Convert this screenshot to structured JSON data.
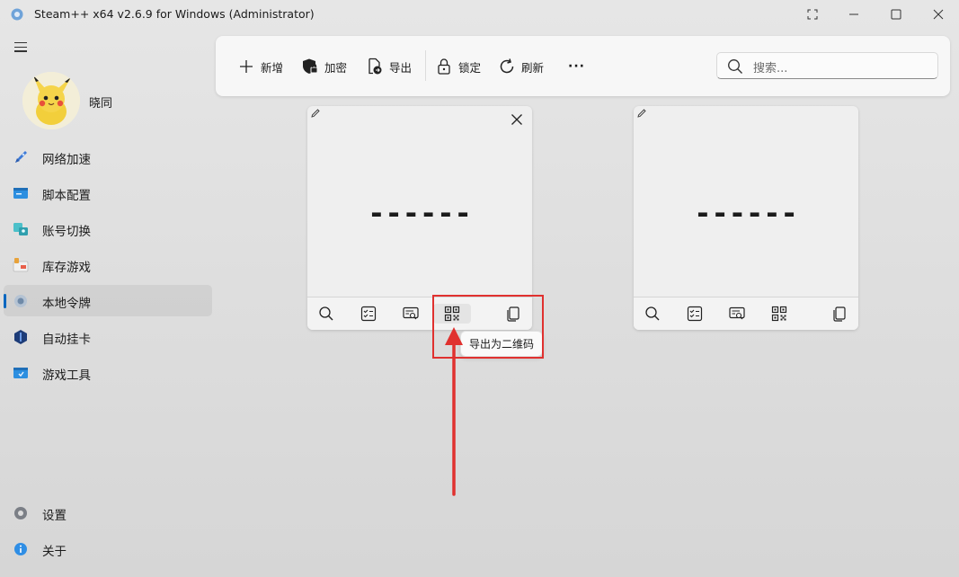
{
  "window": {
    "title": "Steam++ x64 v2.6.9 for Windows (Administrator)",
    "icons": [
      "app-icon",
      "fullscreen-icon",
      "minimize-icon",
      "maximize-icon",
      "close-icon"
    ]
  },
  "sidebar": {
    "username": "晓同",
    "items": [
      {
        "label": "网络加速",
        "icon": "rocket-icon"
      },
      {
        "label": "脚本配置",
        "icon": "script-icon"
      },
      {
        "label": "账号切换",
        "icon": "account-switch-icon"
      },
      {
        "label": "库存游戏",
        "icon": "library-icon"
      },
      {
        "label": "本地令牌",
        "icon": "token-icon",
        "active": true
      },
      {
        "label": "自动挂卡",
        "icon": "idle-card-icon"
      },
      {
        "label": "游戏工具",
        "icon": "game-tools-icon"
      }
    ],
    "settings_label": "设置",
    "about_label": "关于"
  },
  "toolbar": {
    "new_label": "新增",
    "encrypt_label": "加密",
    "export_label": "导出",
    "lock_label": "锁定",
    "refresh_label": "刷新",
    "more_label": "···",
    "search_placeholder": "搜索..."
  },
  "cards": [
    {
      "code": "------",
      "has_close": true
    },
    {
      "code": "------",
      "has_close": false
    }
  ],
  "tooltip": {
    "text": "导出为二维码"
  },
  "colors": {
    "accent": "#0067c0",
    "annotation": "#e0312f"
  }
}
